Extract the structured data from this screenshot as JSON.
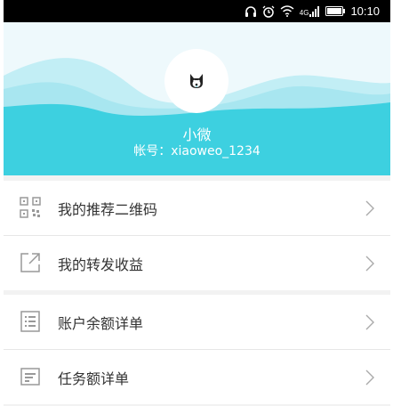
{
  "status_bar": {
    "time": "10:10",
    "network_label": "4G",
    "icons": [
      "headset-icon",
      "alarm-icon",
      "wifi-icon",
      "signal-icon",
      "battery-icon"
    ]
  },
  "profile": {
    "username": "小微",
    "account": "帐号：xiaoweo_1234"
  },
  "colors": {
    "wave_primary": "#3dd0e0",
    "wave_light": "#a8e6f0",
    "background": "#f2f2f2"
  },
  "menu_group_1": [
    {
      "label": "我的推荐二维码",
      "icon": "qrcode-icon"
    },
    {
      "label": "我的转发收益",
      "icon": "share-icon"
    }
  ],
  "menu_group_2": [
    {
      "label": "账户余额详单",
      "icon": "list-icon"
    },
    {
      "label": "任务额详单",
      "icon": "document-icon"
    }
  ]
}
